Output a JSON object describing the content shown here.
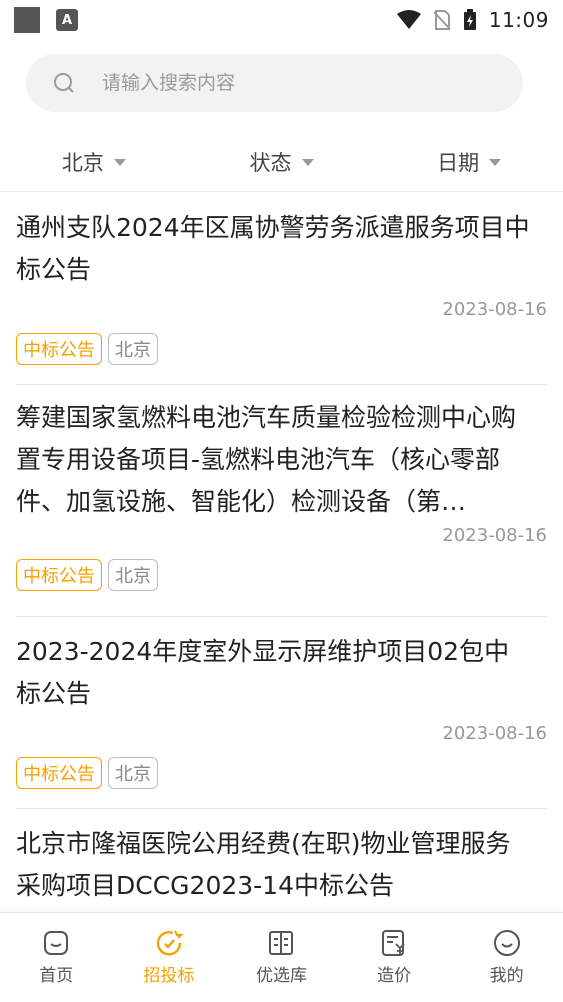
{
  "status_bar": {
    "time": "11:09",
    "small_icon_letter": "A"
  },
  "search": {
    "placeholder": "请输入搜索内容"
  },
  "filters": [
    {
      "label": "北京"
    },
    {
      "label": "状态"
    },
    {
      "label": "日期"
    }
  ],
  "items": [
    {
      "title": "通州支队2024年区属协警劳务派遣服务项目中标公告",
      "date": "2023-08-16",
      "type": "中标公告",
      "city": "北京"
    },
    {
      "title": "筹建国家氢燃料电池汽车质量检验检测中心购置专用设备项目-氢燃料电池汽车（核心零部件、加氢设施、智能化）检测设备（第…",
      "date": "2023-08-16",
      "type": "中标公告",
      "city": "北京"
    },
    {
      "title": "2023-2024年度室外显示屏维护项目02包中标公告",
      "date": "2023-08-16",
      "type": "中标公告",
      "city": "北京"
    },
    {
      "title": "北京市隆福医院公用经费(在职)物业管理服务采购项目DCCG2023-14中标公告"
    }
  ],
  "nav": [
    {
      "label": "首页",
      "icon": "home-icon"
    },
    {
      "label": "招投标",
      "icon": "bid-icon",
      "active": true
    },
    {
      "label": "优选库",
      "icon": "book-icon"
    },
    {
      "label": "造价",
      "icon": "price-icon"
    },
    {
      "label": "我的",
      "icon": "profile-icon"
    }
  ],
  "colors": {
    "accent": "#f5a100",
    "tag_gray": "#bdbdbd"
  }
}
